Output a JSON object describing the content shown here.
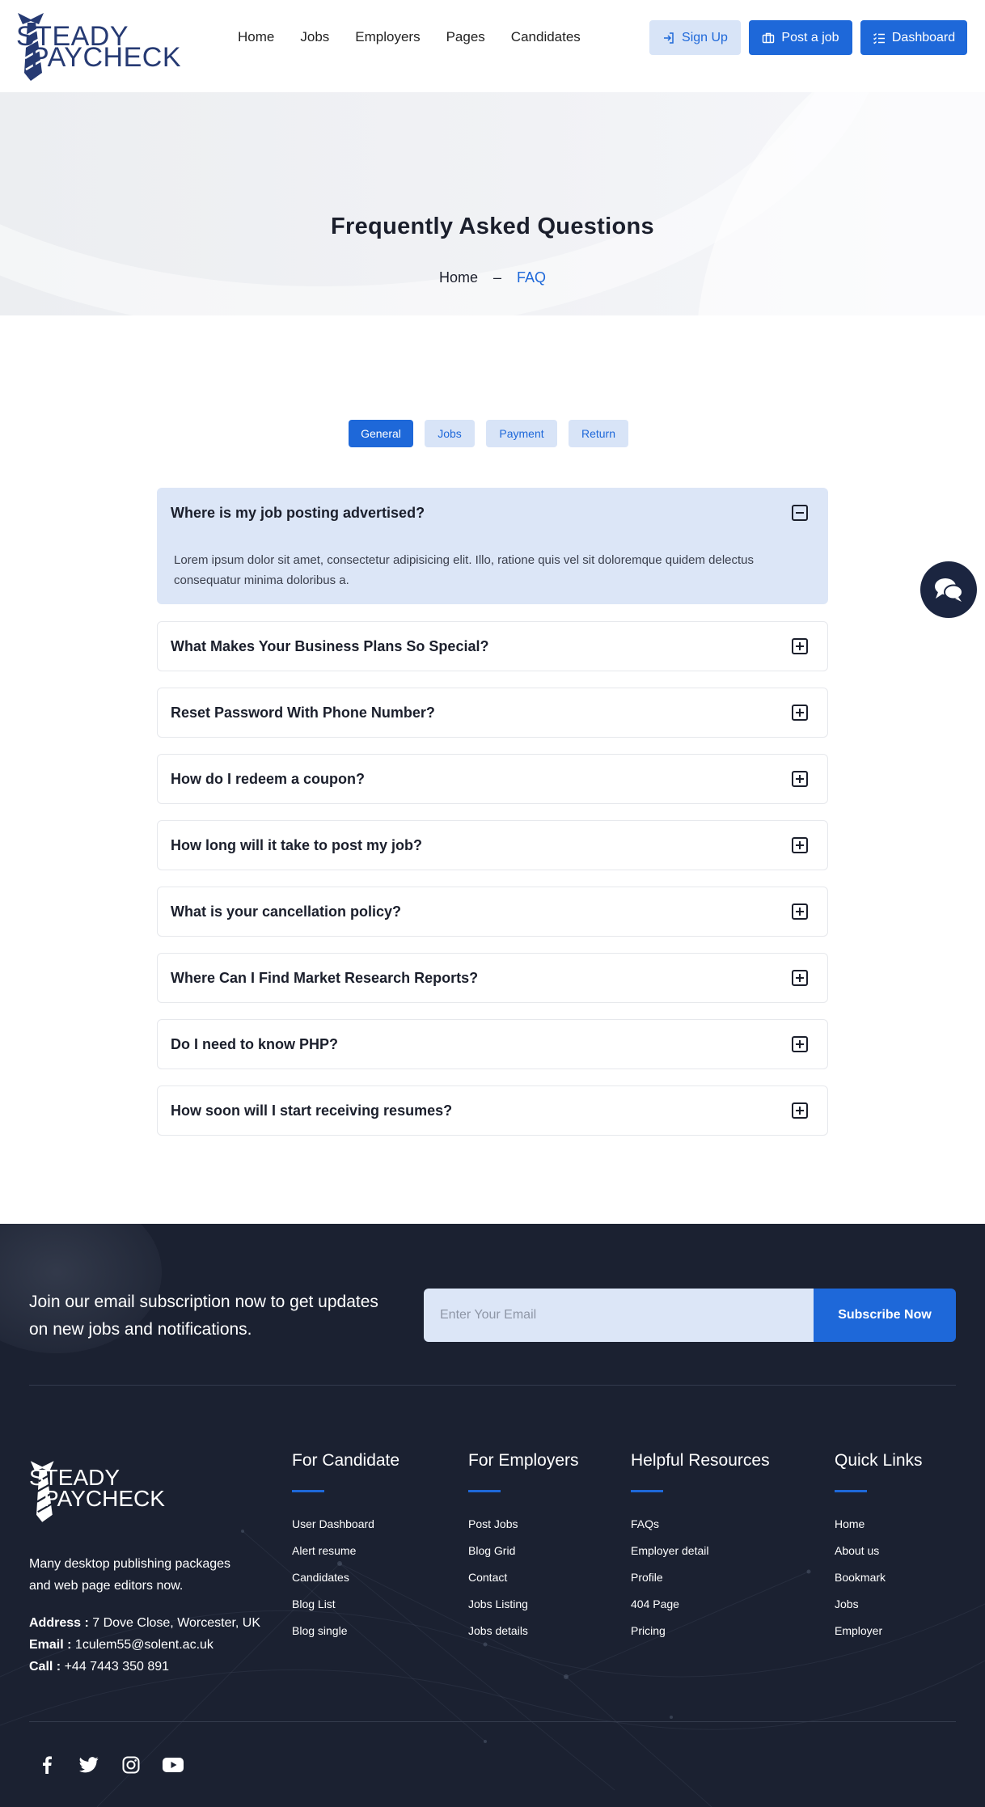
{
  "brand": {
    "logo_line1": "STEADY",
    "logo_line2": "PAYCHECK"
  },
  "nav": {
    "items": [
      "Home",
      "Jobs",
      "Employers",
      "Pages",
      "Candidates"
    ]
  },
  "header_buttons": {
    "signup": "Sign Up",
    "post_job": "Post a job",
    "dashboard": "Dashboard"
  },
  "hero": {
    "title": "Frequently Asked Questions",
    "breadcrumb_home": "Home",
    "breadcrumb_sep": "–",
    "breadcrumb_current": "FAQ"
  },
  "tabs": [
    "General",
    "Jobs",
    "Payment",
    "Return"
  ],
  "active_tab": "General",
  "faqs": [
    {
      "question": "Where is my job posting advertised?",
      "answer": "Lorem ipsum dolor sit amet, consectetur adipisicing elit. Illo, ratione quis vel sit doloremque quidem delectus consequatur minima doloribus a.",
      "open": true
    },
    {
      "question": "What Makes Your Business Plans So Special?",
      "open": false
    },
    {
      "question": "Reset Password With Phone Number?",
      "open": false
    },
    {
      "question": "How do I redeem a coupon?",
      "open": false
    },
    {
      "question": "How long will it take to post my job?",
      "open": false
    },
    {
      "question": "What is your cancellation policy?",
      "open": false
    },
    {
      "question": "Where Can I Find Market Research Reports?",
      "open": false
    },
    {
      "question": "Do I need to know PHP?",
      "open": false
    },
    {
      "question": "How soon will I start receiving resumes?",
      "open": false
    }
  ],
  "footer": {
    "subscribe_text": "Join our email subscription now to get updates on new jobs and notifications.",
    "email_placeholder": "Enter Your Email",
    "subscribe_button": "Subscribe Now",
    "description": "Many desktop publishing packages and web page editors now.",
    "address_label": "Address :",
    "address": "7 Dove Close, Worcester, UK",
    "email_label": "Email :",
    "email": "1culem55@solent.ac.uk",
    "call_label": "Call :",
    "phone": "+44 7443 350 891",
    "columns": [
      {
        "title": "For Candidate",
        "links": [
          "User Dashboard",
          "Alert resume",
          "Candidates",
          "Blog List",
          "Blog single"
        ]
      },
      {
        "title": "For Employers",
        "links": [
          "Post Jobs",
          "Blog Grid",
          "Contact",
          "Jobs Listing",
          "Jobs details"
        ]
      },
      {
        "title": "Helpful Resources",
        "links": [
          "FAQs",
          "Employer detail",
          "Profile",
          "404 Page",
          "Pricing"
        ]
      },
      {
        "title": "Quick Links",
        "links": [
          "Home",
          "About us",
          "Bookmark",
          "Jobs",
          "Employer"
        ]
      }
    ],
    "social": [
      "facebook-icon",
      "twitter-icon",
      "instagram-icon",
      "youtube-icon"
    ]
  },
  "colors": {
    "accent": "#1e68d9",
    "accent_light": "#d8e4f7",
    "footer_bg": "#1b2131",
    "brand_navy": "#263a73"
  }
}
